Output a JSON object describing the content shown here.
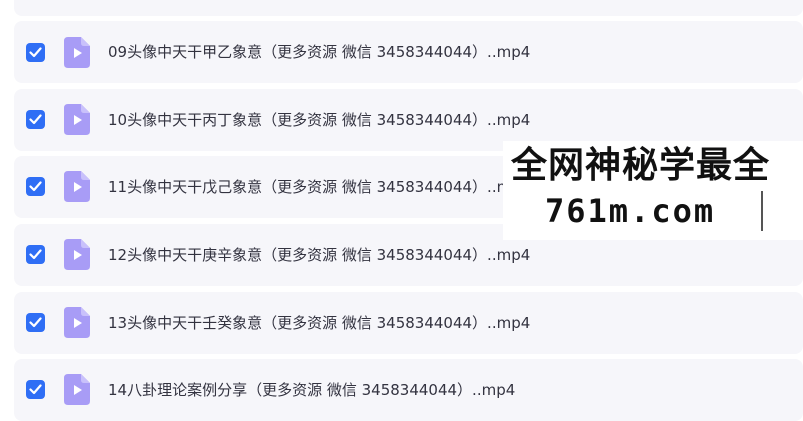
{
  "files": [
    {
      "name": "",
      "checked": true
    },
    {
      "name": "09头像中天干甲乙象意（更多资源 微信 3458344044）..mp4",
      "checked": true
    },
    {
      "name": "10头像中天干丙丁象意（更多资源 微信 3458344044）..mp4",
      "checked": true
    },
    {
      "name": "11头像中天干戊己象意（更多资源 微信 3458344044）..mp4",
      "checked": true
    },
    {
      "name": "12头像中天干庚辛象意（更多资源 微信 3458344044）..mp4",
      "checked": true
    },
    {
      "name": "13头像中天干壬癸象意（更多资源 微信 3458344044）..mp4",
      "checked": true
    },
    {
      "name": "14八卦理论案例分享（更多资源 微信 3458344044）..mp4",
      "checked": true
    }
  ],
  "watermark": {
    "line1": "全网神秘学最全",
    "line2": "761m.com"
  },
  "colors": {
    "row_bg": "#f6f6fa",
    "checkbox": "#2f6ef5",
    "file_icon": "#a89cf6"
  },
  "icons": {
    "checkbox": "checkbox-checked-icon",
    "file": "video-file-icon"
  }
}
